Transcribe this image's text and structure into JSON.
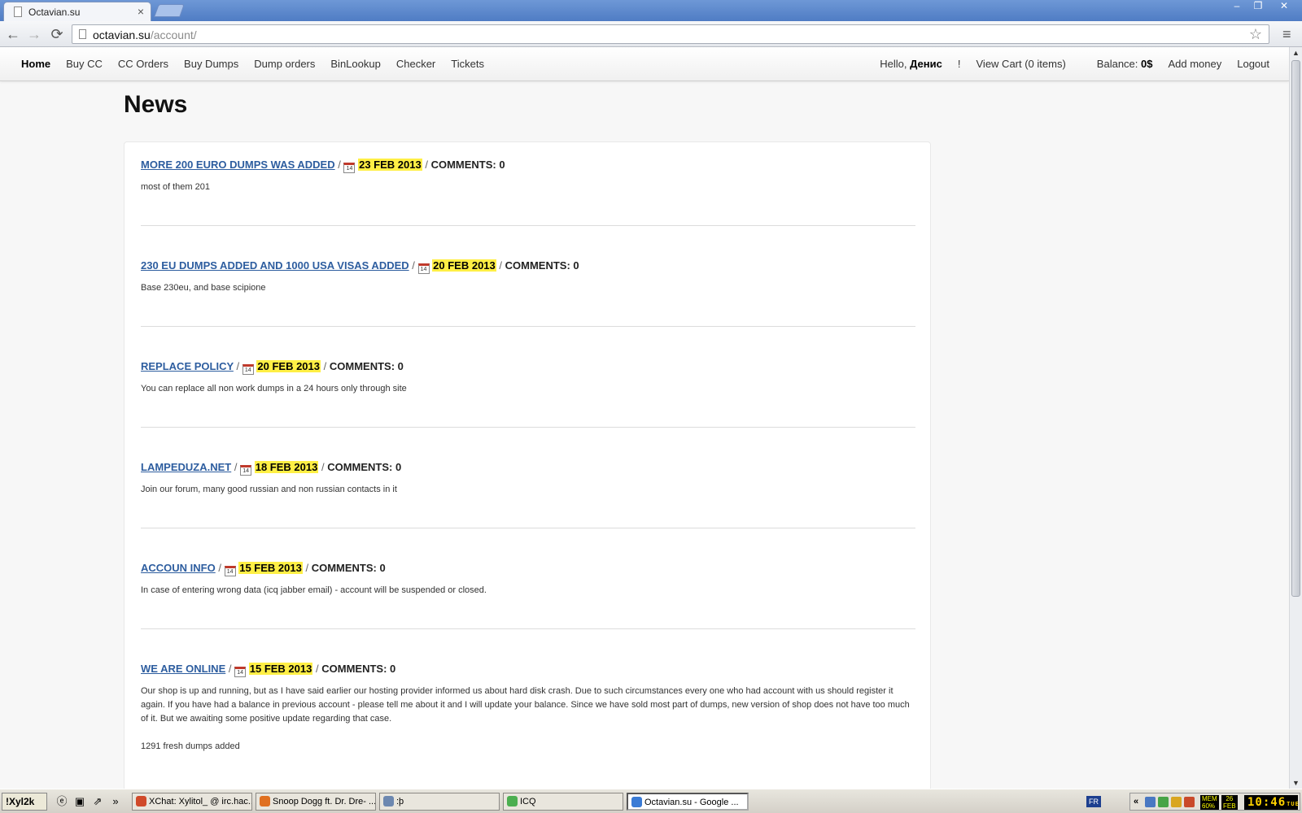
{
  "browser": {
    "tab_title": "Octavian.su",
    "tab_close": "×",
    "url_host": "octavian.su",
    "url_path": "/account/",
    "window_min": "–",
    "window_max": "❐",
    "window_close": "✕",
    "back": "←",
    "forward": "→",
    "reload": "⟳",
    "star": "☆",
    "menu": "≡"
  },
  "nav": {
    "left": [
      "Home",
      "Buy CC",
      "CC Orders",
      "Buy Dumps",
      "Dump orders",
      "BinLookup",
      "Checker",
      "Tickets"
    ],
    "hello_prefix": "Hello, ",
    "hello_name": "Денис",
    "hello_suffix": "!",
    "view_cart": "View Cart (0 items)",
    "balance_label": "Balance: ",
    "balance_value": "0$",
    "add_money": "Add money",
    "logout": "Logout"
  },
  "page": {
    "title": "News"
  },
  "news": [
    {
      "title": "MORE 200 EURO DUMPS WAS ADDED",
      "date": "23 FEB 2013",
      "comments": "COMMENTS: 0",
      "body": [
        "most of them 201"
      ]
    },
    {
      "title": "230 EU DUMPS ADDED AND 1000 USA VISAS ADDED",
      "date": "20 FEB 2013",
      "comments": "COMMENTS: 0",
      "body": [
        "Base 230eu, and base scipione"
      ]
    },
    {
      "title": "REPLACE POLICY",
      "date": "20 FEB 2013",
      "comments": "COMMENTS: 0",
      "body": [
        "You can replace all non work dumps in a 24 hours only through site"
      ]
    },
    {
      "title": "LAMPEDUZA.NET",
      "date": "18 FEB 2013",
      "comments": "COMMENTS: 0",
      "body": [
        "Join our forum, many good russian and non russian contacts in it"
      ]
    },
    {
      "title": "ACCOUN INFO",
      "date": "15 FEB 2013",
      "comments": "COMMENTS: 0",
      "body": [
        "In case of entering wrong data (icq jabber email) - account will be suspended or closed."
      ]
    },
    {
      "title": "WE ARE ONLINE",
      "date": "15 FEB 2013",
      "comments": "COMMENTS: 0",
      "body": [
        "Our shop is up and running, but as I have said earlier our hosting provider informed us about hard disk crash. Due to such circumstances every one who had account with us should register it again. If you have had a balance in previous account - please tell me about it and I will update your balance. Since we have sold most part of dumps, new version of shop does not have too much of it. But we awaiting some positive update regarding that case.",
        "1291 fresh dumps added"
      ]
    }
  ],
  "separator": "/",
  "calendar_icon_text": "14",
  "taskbar": {
    "start_label": "!Xyl2k",
    "more": "»",
    "tasks": [
      {
        "label": "XChat: Xylitol_ @ irc.hac...",
        "color": "#d04a2a"
      },
      {
        "label": "Snoop Dogg ft. Dr. Dre- ...",
        "color": "#e07020"
      },
      {
        "label": ":þ",
        "color": "#6d88b0"
      },
      {
        "label": "ICQ",
        "color": "#4caf50"
      },
      {
        "label": "Octavian.su - Google ...",
        "color": "#3a7bd5"
      }
    ],
    "lang": "FR",
    "tray_chevron": "«",
    "mem_label": "MEM\n60%",
    "day": "26",
    "month": "FEB",
    "clock": "10:46",
    "weekday": "TUE"
  }
}
